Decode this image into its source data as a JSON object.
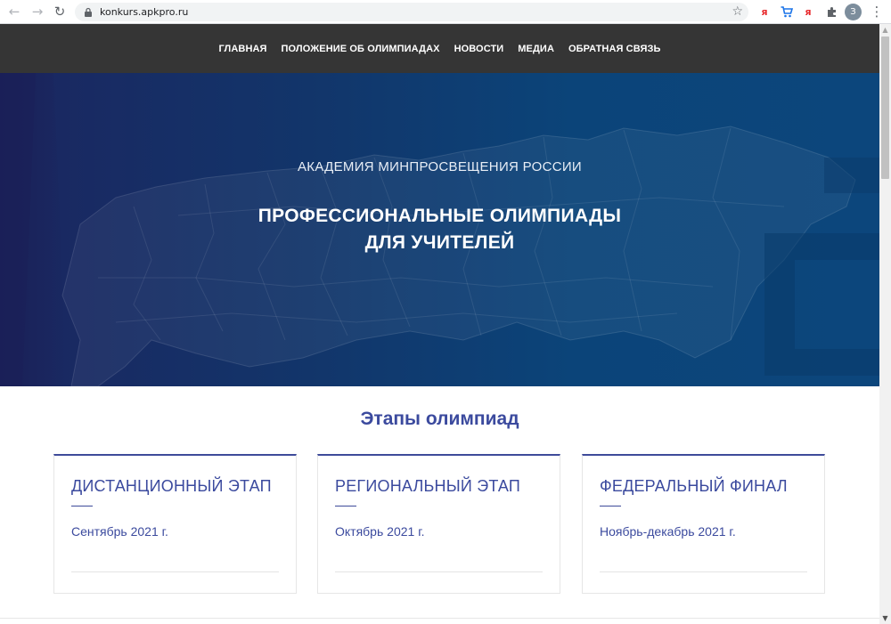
{
  "browser": {
    "url": "konkurs.apkpro.ru",
    "profile_initial": "З",
    "extensions": [
      {
        "name": "yandex-icon",
        "glyph": "я",
        "color": "#e8292c"
      },
      {
        "name": "cart-icon",
        "glyph": "🛒",
        "color": "#1a73e8"
      },
      {
        "name": "yandex-icon-2",
        "glyph": "я",
        "color": "#e8292c"
      },
      {
        "name": "puzzle-icon",
        "glyph": "✚",
        "color": "#5f6368"
      }
    ]
  },
  "nav": {
    "items": [
      "ГЛАВНАЯ",
      "ПОЛОЖЕНИЕ ОБ ОЛИМПИАДАХ",
      "НОВОСТИ",
      "МЕДИА",
      "ОБРАТНАЯ СВЯЗЬ"
    ]
  },
  "hero": {
    "kicker": "АКАДЕМИЯ МИНПРОСВЕЩЕНИЯ РОССИИ",
    "title_line1": "ПРОФЕССИОНАЛЬНЫЕ ОЛИМПИАДЫ",
    "title_line2": "ДЛЯ УЧИТЕЛЕЙ"
  },
  "stages": {
    "heading": "Этапы олимпиад",
    "cards": [
      {
        "title": "ДИСТАНЦИОННЫЙ ЭТАП",
        "date": "Сентябрь 2021 г."
      },
      {
        "title": "РЕГИОНАЛЬНЫЙ ЭТАП",
        "date": "Октябрь 2021 г."
      },
      {
        "title": "ФЕДЕРАЛЬНЫЙ ФИНАЛ",
        "date": "Ноябрь-декабрь 2021 г."
      }
    ]
  },
  "colors": {
    "nav_bg": "#353535",
    "accent": "#3b4a9e",
    "hero_dark": "#1b2660",
    "hero_light": "#0c467c"
  }
}
